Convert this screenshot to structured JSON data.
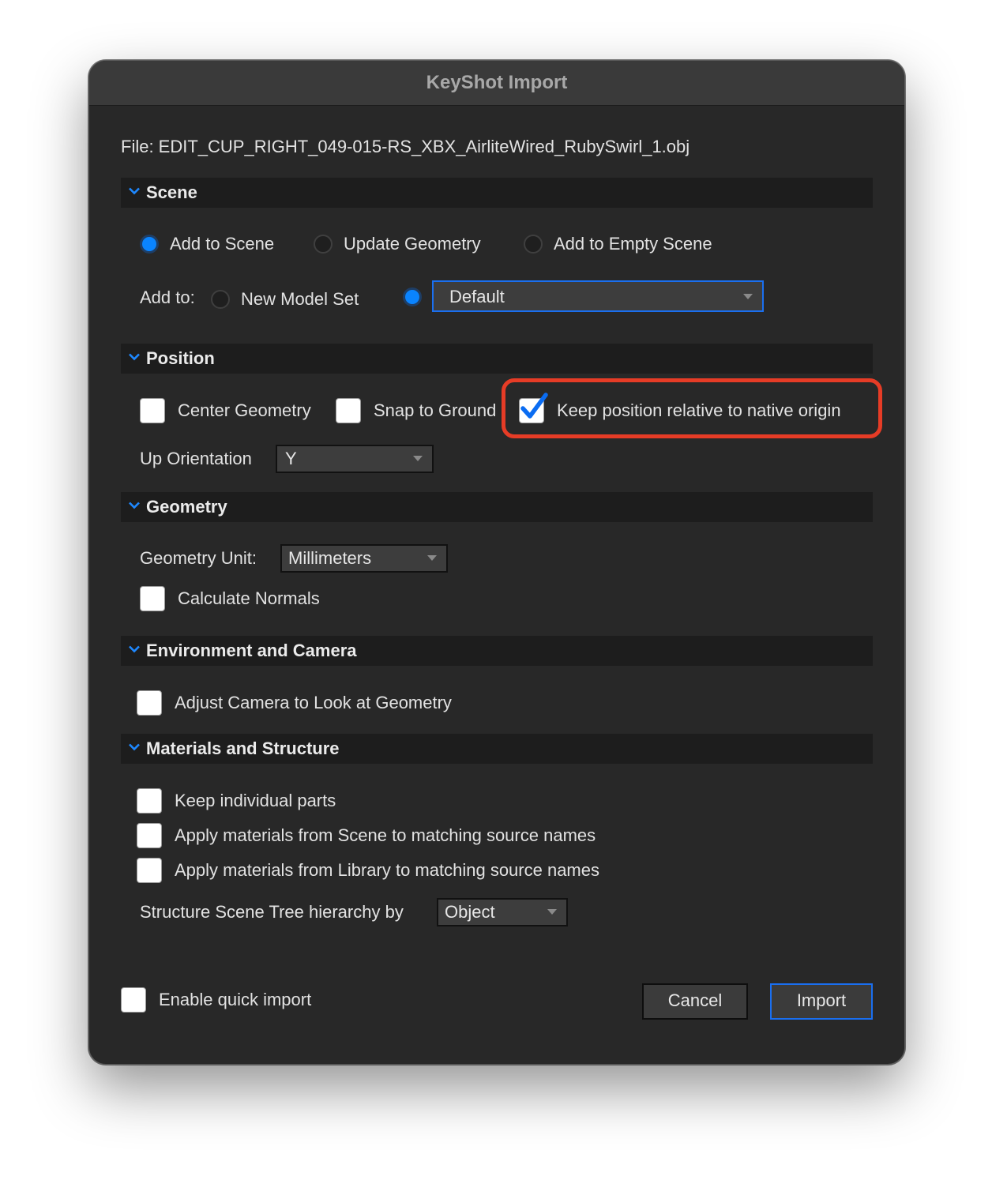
{
  "window": {
    "title": "KeyShot Import"
  },
  "file_label": "File: EDIT_CUP_RIGHT_049-015-RS_XBX_AirliteWired_RubySwirl_1.obj",
  "colors": {
    "accent": "#0a84ff",
    "highlight": "#e63c26",
    "background": "#282828"
  },
  "scene": {
    "header": "Scene",
    "options": [
      "Add to Scene",
      "Update Geometry",
      "Add to Empty Scene"
    ],
    "selected": "Add to Scene",
    "add_to_label": "Add to:",
    "new_model_set": "New Model Set",
    "model_set_value": "Default"
  },
  "position": {
    "header": "Position",
    "center_geometry": "Center Geometry",
    "snap_to_ground": "Snap to Ground",
    "keep_position": "Keep position relative to native origin",
    "keep_position_checked": true,
    "up_orientation_label": "Up Orientation",
    "up_orientation_value": "Y"
  },
  "geometry": {
    "header": "Geometry",
    "unit_label": "Geometry Unit:",
    "unit_value": "Millimeters",
    "calculate_normals": "Calculate Normals"
  },
  "environment": {
    "header": "Environment and Camera",
    "adjust_camera": "Adjust Camera to Look at Geometry"
  },
  "materials": {
    "header": "Materials and Structure",
    "keep_parts": "Keep individual parts",
    "apply_scene": "Apply materials from Scene to matching source names",
    "apply_library": "Apply materials from Library to matching source names",
    "structure_label": "Structure Scene Tree hierarchy by",
    "structure_value": "Object"
  },
  "footer": {
    "quick_import": "Enable quick import",
    "cancel": "Cancel",
    "import": "Import"
  }
}
